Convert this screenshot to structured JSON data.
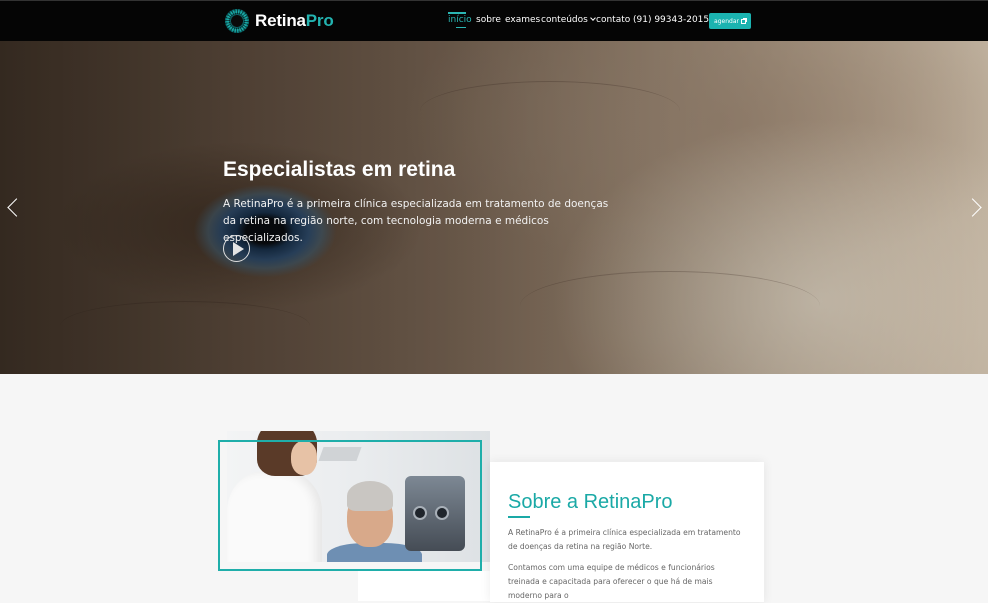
{
  "brand": {
    "name_part1": "Retina",
    "name_part2": "Pro"
  },
  "nav": {
    "items": [
      {
        "label": "início",
        "active": true
      },
      {
        "label": "sobre"
      },
      {
        "label": "exames"
      },
      {
        "label": "conteúdos",
        "has_dropdown": true
      },
      {
        "label": "contato"
      }
    ],
    "phone": "(91) 99343-2015",
    "cta_label": "agendar"
  },
  "hero": {
    "title": "Especialistas em retina",
    "text": "A RetinaPro é a primeira clínica especializada em tratamento de doenças da retina na região norte, com tecnologia moderna e médicos especializados."
  },
  "about": {
    "title": "Sobre a RetinaPro",
    "paragraph1": "A RetinaPro é a primeira clínica especializada em tratamento de doenças da retina na região Norte.",
    "paragraph2": "Contamos com uma equipe de médicos e funcionários treinada e capacitada para oferecer o que há de mais moderno para o"
  },
  "colors": {
    "accent": "#1aa9a6",
    "navbar": "#050505"
  },
  "icons": [
    "logo-mark-icon",
    "whatsapp-icon",
    "external-link-icon",
    "chevron-down-icon",
    "play-icon",
    "arrow-left-icon",
    "arrow-right-icon"
  ]
}
